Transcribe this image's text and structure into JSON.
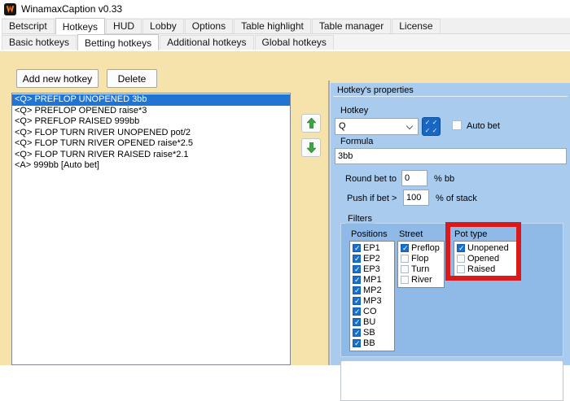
{
  "window": {
    "title": "WinamaxCaption v0.33",
    "icon": "winamax-flame-logo"
  },
  "tabs": {
    "main": {
      "items": [
        "Betscript",
        "Hotkeys",
        "HUD",
        "Lobby",
        "Options",
        "Table highlight",
        "Table manager",
        "License"
      ],
      "selected": "Hotkeys",
      "selected_index": 1
    },
    "sub": {
      "items": [
        "Basic hotkeys",
        "Betting hotkeys",
        "Additional hotkeys",
        "Global hotkeys"
      ],
      "selected": "Betting hotkeys",
      "selected_index": 1
    }
  },
  "toolbar": {
    "add_button": "Add new hotkey",
    "delete_button": "Delete"
  },
  "hotkey_list": {
    "selected_index": 0,
    "items": [
      "<Q> PREFLOP UNOPENED 3bb",
      "<Q> PREFLOP OPENED raise*3",
      "<Q> PREFLOP RAISED 999bb",
      "<Q> FLOP TURN RIVER UNOPENED pot/2",
      "<Q> FLOP TURN RIVER OPENED raise*2.5",
      "<Q> FLOP TURN RIVER RAISED raise*2.1",
      "<A> 999bb [Auto bet]"
    ]
  },
  "move_buttons": {
    "up_icon": "green-up-arrow",
    "down_icon": "green-down-arrow"
  },
  "properties": {
    "title": "Hotkey's properties",
    "hotkey_label": "Hotkey",
    "hotkey_value": "Q",
    "keyboard_button_icon": "four-checks-keyboard",
    "auto_bet_label": "Auto bet",
    "auto_bet_checked": false,
    "formula_label": "Formula",
    "formula_value": "3bb",
    "round_label": "Round bet to",
    "round_value": "0",
    "round_suffix": "% bb",
    "push_label": "Push if bet >",
    "push_value": "100",
    "push_suffix": "% of stack",
    "filters": {
      "title": "Filters",
      "columns": [
        {
          "label": "Positions",
          "options": [
            {
              "label": "EP1",
              "checked": true
            },
            {
              "label": "EP2",
              "checked": true
            },
            {
              "label": "EP3",
              "checked": true
            },
            {
              "label": "MP1",
              "checked": true
            },
            {
              "label": "MP2",
              "checked": true
            },
            {
              "label": "MP3",
              "checked": true
            },
            {
              "label": "CO",
              "checked": true
            },
            {
              "label": "BU",
              "checked": true
            },
            {
              "label": "SB",
              "checked": true
            },
            {
              "label": "BB",
              "checked": true
            }
          ]
        },
        {
          "label": "Street",
          "options": [
            {
              "label": "Preflop",
              "checked": true
            },
            {
              "label": "Flop",
              "checked": false
            },
            {
              "label": "Turn",
              "checked": false
            },
            {
              "label": "River",
              "checked": false
            }
          ]
        },
        {
          "label": "Pot type",
          "highlighted": true,
          "options": [
            {
              "label": "Unopened",
              "checked": true
            },
            {
              "label": "Opened",
              "checked": false
            },
            {
              "label": "Raised",
              "checked": false
            }
          ]
        }
      ]
    }
  },
  "colors": {
    "page_tan": "#F6E3AC",
    "panel_blue": "#A9CBED",
    "filters_blue": "#8FB9E7",
    "selection_blue": "#2074D4",
    "checkbox_blue": "#1770CC",
    "arrow_green": "#3FA243",
    "highlight_red": "#DA1A1A",
    "logo_orange": "#F08019"
  }
}
